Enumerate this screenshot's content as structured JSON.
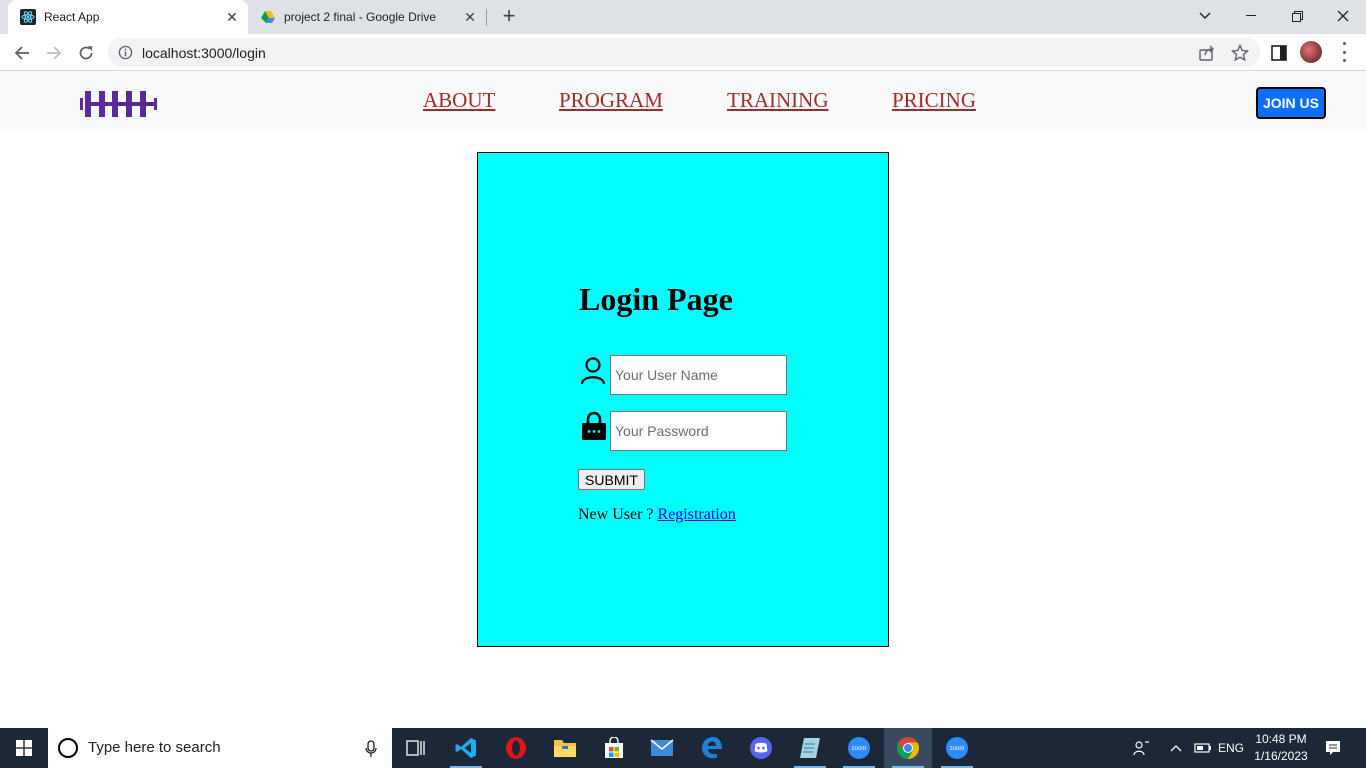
{
  "browser": {
    "tabs": [
      {
        "title": "React App",
        "favicon": "react-icon"
      },
      {
        "title": "project 2 final - Google Drive",
        "favicon": "google-drive-icon"
      }
    ],
    "url": "localhost:3000/login"
  },
  "navbar": {
    "links": [
      "ABOUT",
      "PROGRAM",
      "TRAINING",
      "PRICING"
    ],
    "join_label": "JOIN US",
    "colors": {
      "link": "#a52a2a",
      "join_button": "#0d6efd",
      "logo": "#5b2a9a"
    }
  },
  "login": {
    "title": "Login Page",
    "username_placeholder": "Your User Name",
    "password_placeholder": "Your Password",
    "submit_label": "SUBMIT",
    "new_user_text": "New User ?",
    "registration_link": "Registration",
    "background": "#00ffff"
  },
  "taskbar": {
    "search_placeholder": "Type here to search",
    "apps": [
      "task-view-icon",
      "vscode-icon",
      "opera-icon",
      "file-explorer-icon",
      "microsoft-store-icon",
      "mail-icon",
      "edge-icon",
      "discord-icon",
      "notepad-icon",
      "zoom-icon",
      "chrome-icon",
      "zoom-icon"
    ],
    "language": "ENG",
    "time": "10:48 PM",
    "date": "1/16/2023"
  }
}
